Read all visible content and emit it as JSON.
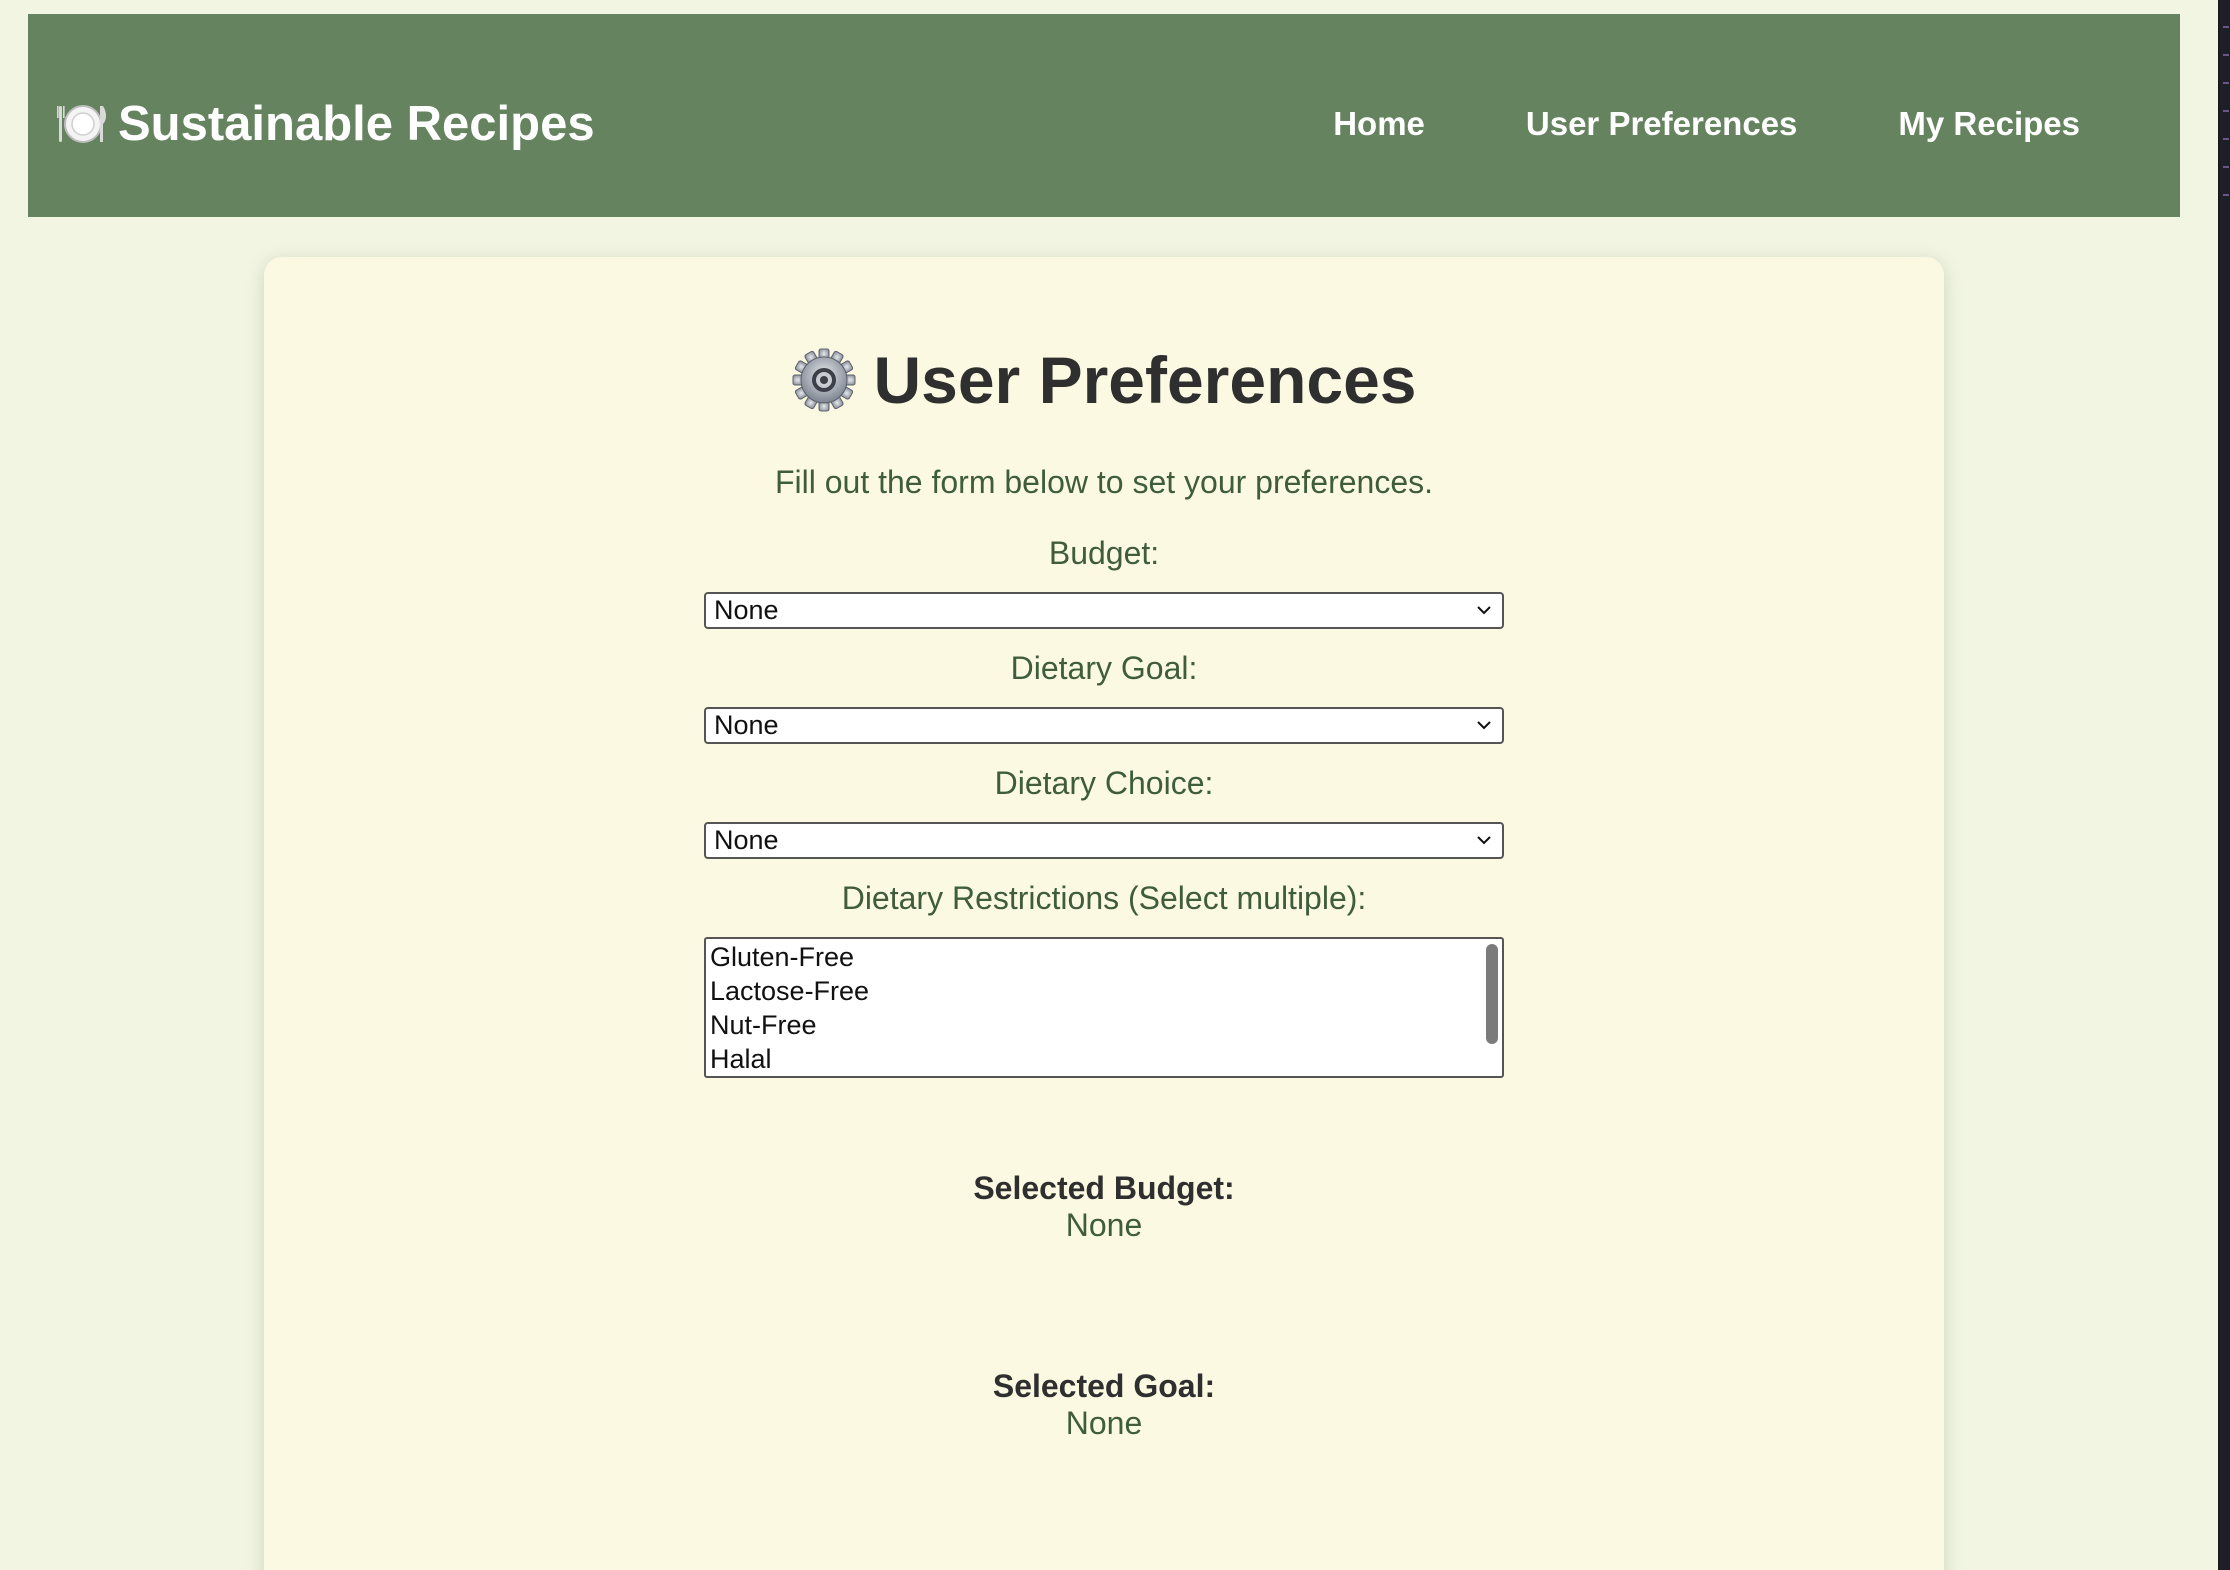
{
  "header": {
    "brand_icon": "plate-with-cutlery-icon",
    "brand_title": "Sustainable Recipes",
    "nav": [
      {
        "label": "Home"
      },
      {
        "label": "User Preferences"
      },
      {
        "label": "My Recipes"
      }
    ],
    "colors": {
      "navbar": "#64835e",
      "nav_text": "#ffffff"
    }
  },
  "main": {
    "title_icon": "gear-icon",
    "title": "User Preferences",
    "subtitle": "Fill out the form below to set your preferences.",
    "budget": {
      "label": "Budget:",
      "selected": "None"
    },
    "goal": {
      "label": "Dietary Goal:",
      "selected": "None"
    },
    "choice": {
      "label": "Dietary Choice:",
      "selected": "None"
    },
    "restrictions": {
      "label": "Dietary Restrictions (Select multiple):",
      "options": [
        "Gluten-Free",
        "Lactose-Free",
        "Nut-Free",
        "Halal"
      ]
    },
    "summary": {
      "budget_label": "Selected Budget:",
      "budget_value": "None",
      "goal_label": "Selected Goal:",
      "goal_value": "None"
    },
    "colors": {
      "page_bg": "#f1f5e2",
      "card_bg": "#fbf9e2",
      "text_green": "#3f5d3b",
      "text_dark": "#2f2f2f"
    }
  }
}
